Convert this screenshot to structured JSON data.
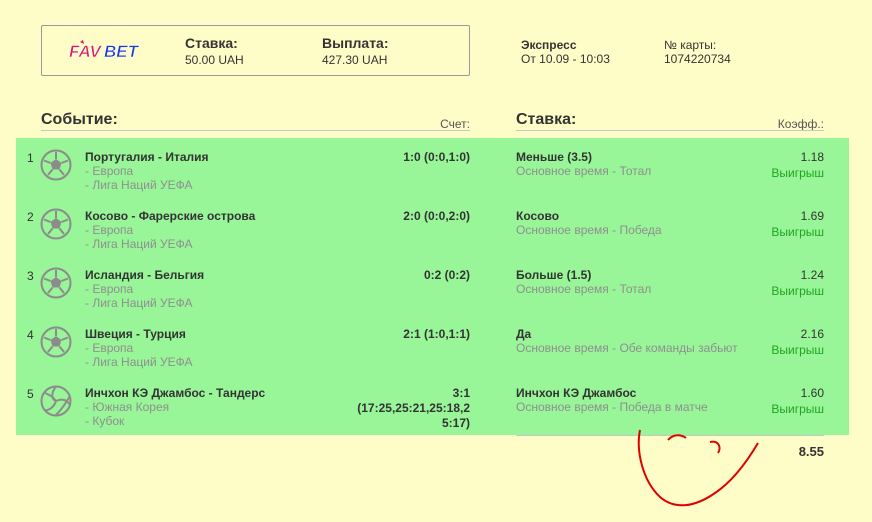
{
  "brand": {
    "logo_text": "FAVBET",
    "colors": {
      "fav": "#e0195a",
      "bet": "#1d3ad6"
    }
  },
  "ticket": {
    "stake_label": "Ставка:",
    "stake_value": "50.00 UAH",
    "payout_label": "Выплата:",
    "payout_value": "427.30 UAH"
  },
  "info": {
    "type_label": "Экспресс",
    "date_value": "От 10.09 - 10:03",
    "card_label": "№ карты:",
    "card_value": "1074220734"
  },
  "sections": {
    "event_title": "Событие:",
    "score_label": "Счет:",
    "bet_title": "Ставка:",
    "coef_label": "Коэфф.:"
  },
  "rows": [
    {
      "num": "1",
      "sport_icon": "soccer-ball-icon",
      "match": "Португалия - Италия",
      "sub1": "- Европа",
      "sub2": "- Лига Наций УЕФА",
      "score": "1:0 (0:0,1:0)",
      "pick": "Меньше (3.5)",
      "pick_sub": "Основное время - Тотал",
      "coef": "1.18",
      "result": "Выигрыш"
    },
    {
      "num": "2",
      "sport_icon": "soccer-ball-icon",
      "match": "Косово - Фарерские острова",
      "sub1": "- Европа",
      "sub2": "- Лига Наций УЕФА",
      "score": "2:0 (0:0,2:0)",
      "pick": "Косово",
      "pick_sub": "Основное время - Победа",
      "coef": "1.69",
      "result": "Выигрыш"
    },
    {
      "num": "3",
      "sport_icon": "soccer-ball-icon",
      "match": "Исландия - Бельгия",
      "sub1": "- Европа",
      "sub2": "- Лига Наций УЕФА",
      "score": "0:2 (0:2)",
      "pick": "Больше (1.5)",
      "pick_sub": "Основное время - Тотал",
      "coef": "1.24",
      "result": "Выигрыш"
    },
    {
      "num": "4",
      "sport_icon": "soccer-ball-icon",
      "match": "Швеция - Турция",
      "sub1": "- Европа",
      "sub2": "- Лига Наций УЕФА",
      "score": "2:1 (1:0,1:1)",
      "pick": "Да",
      "pick_sub": "Основное время - Обе команды забьют",
      "coef": "2.16",
      "result": "Выигрыш"
    },
    {
      "num": "5",
      "sport_icon": "volleyball-icon",
      "match": "Инчхон КЭ Джамбос - Тандерс",
      "sub1": "- Южная Корея",
      "sub2": "- Кубок",
      "score_lines": [
        "3:1",
        "(17:25,25:21,25:18,2",
        "5:17)"
      ],
      "pick": "Инчхон КЭ Джамбос",
      "pick_sub": "Основное время - Победа в матче",
      "coef": "1.60",
      "result": "Выигрыш"
    }
  ],
  "total_coef": "8.55",
  "colors": {
    "win_green": "#1fa51f",
    "row_bg": "#98f598",
    "page_bg": "#fefdc8",
    "scribble_red": "#e00000"
  }
}
